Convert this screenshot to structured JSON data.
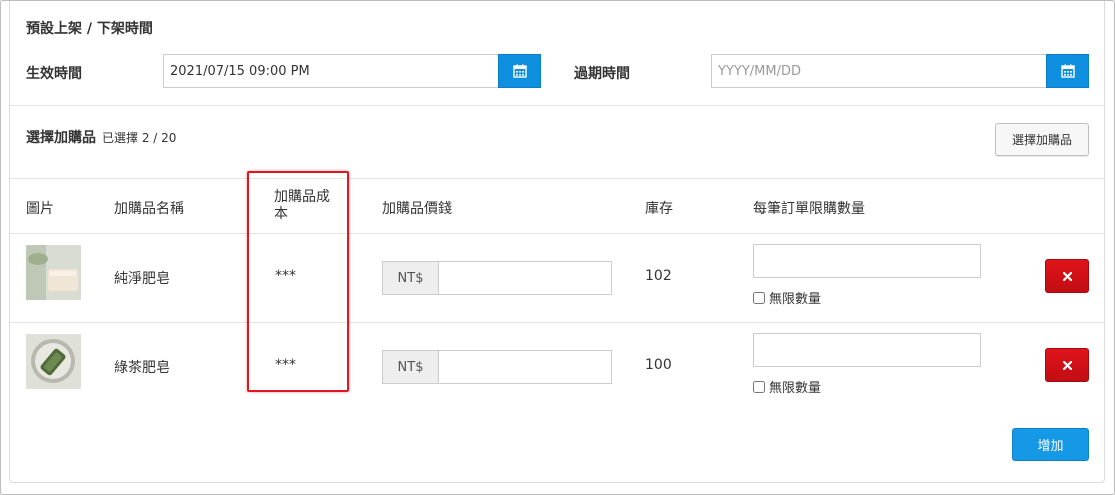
{
  "schedule": {
    "title": "預設上架 / 下架時間",
    "effective_label": "生效時間",
    "effective_value": "2021/07/15 09:00 PM",
    "expire_label": "過期時間",
    "expire_placeholder": "YYYY/MM/DD"
  },
  "addons": {
    "title": "選擇加購品",
    "selected_text": "已選擇 2 / 20",
    "select_button": "選擇加購品",
    "columns": {
      "image": "圖片",
      "name": "加購品名稱",
      "cost_line1": "加購品成",
      "cost_line2": "本",
      "price": "加購品價錢",
      "stock": "庫存",
      "limit": "每筆訂單限購數量"
    },
    "rows": [
      {
        "name": "純淨肥皂",
        "cost": "***",
        "currency": "NT$",
        "stock": "102",
        "unlimited_label": "無限數量",
        "remove_icon": "times-icon"
      },
      {
        "name": "綠茶肥皂",
        "cost": "***",
        "currency": "NT$",
        "stock": "100",
        "unlimited_label": "無限數量",
        "remove_icon": "times-icon"
      }
    ],
    "add_button": "增加"
  },
  "colors": {
    "primary": "#1598e6",
    "danger": "#d21117",
    "highlight": "#e3161e"
  },
  "icons": {
    "calendar": "calendar-icon",
    "remove": "times-icon"
  }
}
